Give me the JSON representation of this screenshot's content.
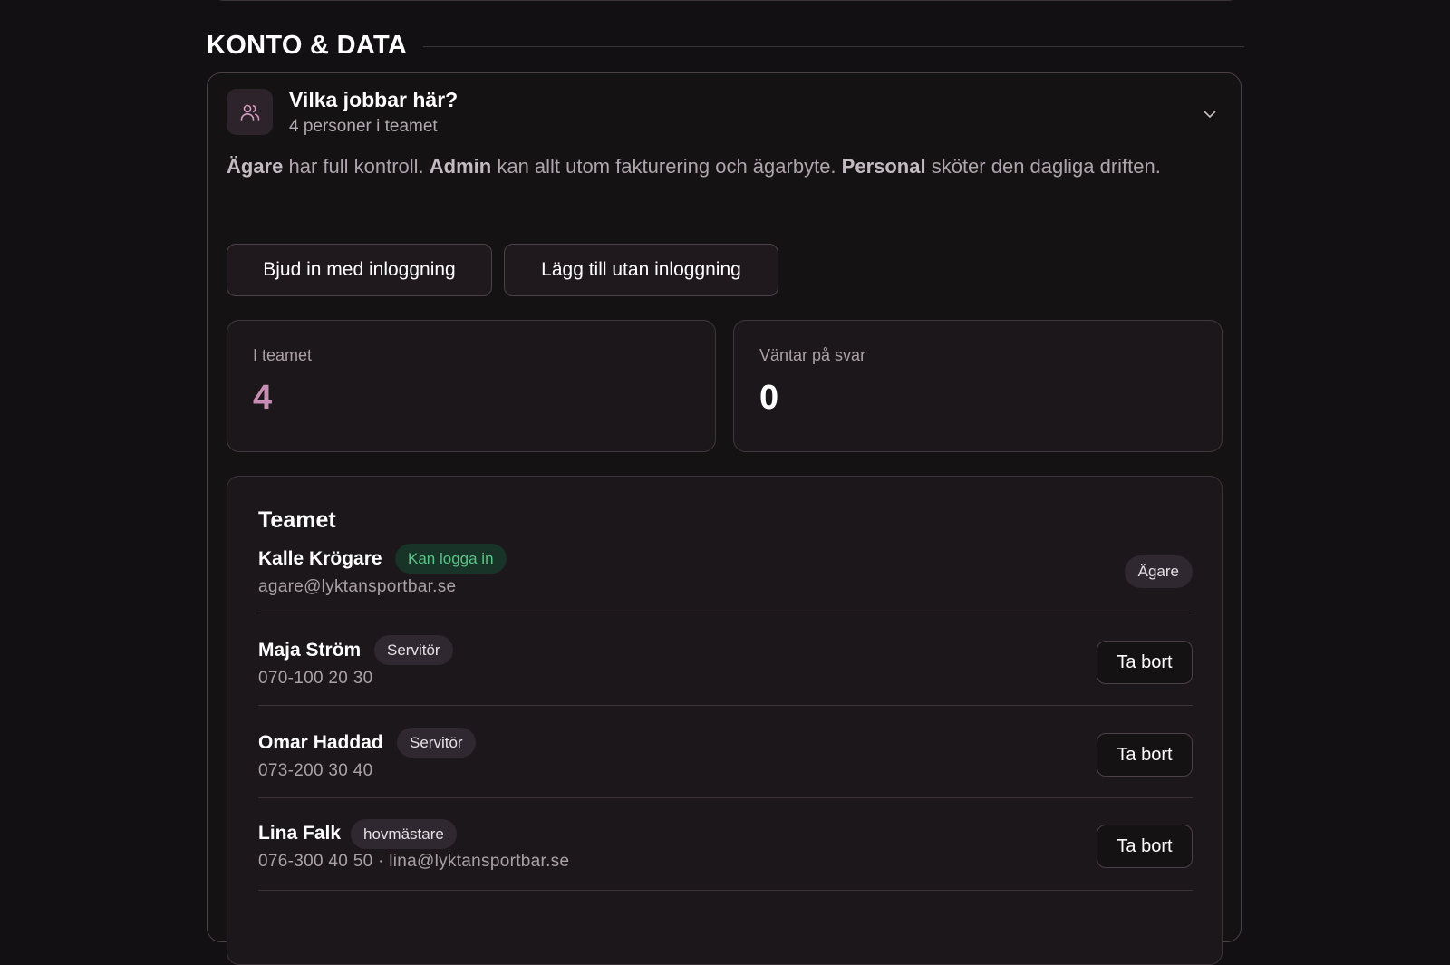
{
  "section": {
    "title": "KONTO & DATA"
  },
  "panel": {
    "title": "Vilka jobbar här?",
    "subtitle": "4 personer i teamet",
    "icon": "users-icon",
    "description": {
      "owner_role": "Ägare",
      "owner_text": " har full kontroll. ",
      "admin_role": "Admin",
      "admin_text": " kan allt utom fakturering och ägarbyte. ",
      "staff_role": "Personal",
      "staff_text": " sköter den dagliga driften."
    },
    "buttons": {
      "invite_label": "Bjud in med inloggning",
      "add_label": "Lägg till utan inloggning"
    }
  },
  "stats": {
    "team_label": "I teamet",
    "team_value": "4",
    "pending_label": "Väntar på svar",
    "pending_value": "0"
  },
  "team": {
    "title": "Teamet",
    "members": [
      {
        "name": "Kalle Krögare",
        "tag": "Kan logga in",
        "contact": "agare@lyktansportbar.se",
        "role_badge": "Ägare"
      },
      {
        "name": "Maja Ström",
        "tag": "Servitör",
        "contact": "070-100 20 30",
        "action": "Ta bort"
      },
      {
        "name": "Omar Haddad",
        "tag": "Servitör",
        "contact": "073-200 30 40",
        "action": "Ta bort"
      },
      {
        "name": "Lina Falk",
        "tag": "hovmästare",
        "contact": "076-300 40 50 · lina@lyktansportbar.se",
        "action": "Ta bort"
      }
    ]
  },
  "colors": {
    "background": "#121012",
    "accent": "#c98db5",
    "success": "#55c785"
  }
}
